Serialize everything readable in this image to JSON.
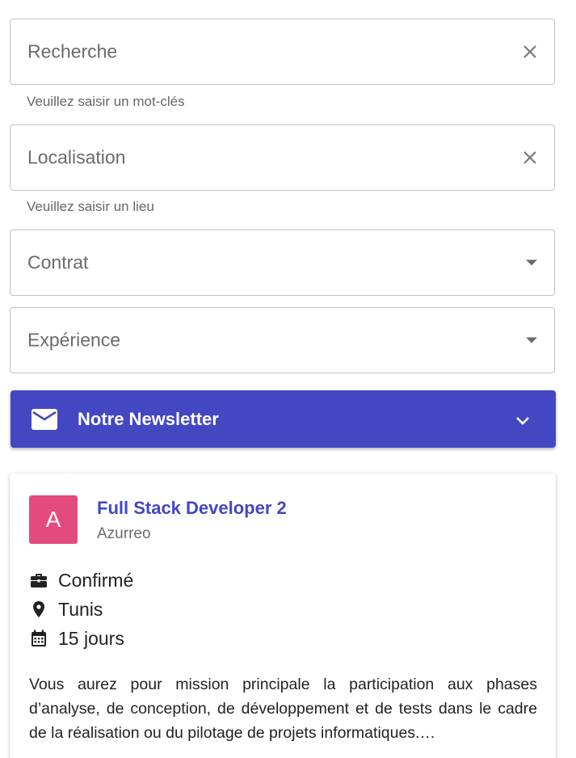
{
  "search": {
    "placeholder": "Recherche",
    "helper": "Veuillez saisir un mot-clés",
    "clear_icon": "close-icon"
  },
  "location": {
    "placeholder": "Localisation",
    "helper": "Veuillez saisir un lieu",
    "clear_icon": "close-icon"
  },
  "contract": {
    "placeholder": "Contrat",
    "icon": "caret-down-icon"
  },
  "experience": {
    "placeholder": "Expérience",
    "icon": "caret-down-icon"
  },
  "newsletter": {
    "title": "Notre Newsletter",
    "icon": "mail-icon",
    "expand_icon": "chevron-down-icon",
    "color": "#4447c2"
  },
  "job": {
    "avatar_letter": "A",
    "avatar_color": "#e34b7f",
    "title": "Full Stack Developer 2",
    "company": "Azurreo",
    "level": "Confirmé",
    "level_icon": "briefcase-icon",
    "location": "Tunis",
    "location_icon": "map-pin-icon",
    "posted": "15 jours",
    "posted_icon": "calendar-icon",
    "description": "Vous aurez pour mission principale la participation aux phases d’analyse, de conception, de développement et de tests dans le cadre de la réalisation ou du pilotage de projets informatiques.…"
  }
}
